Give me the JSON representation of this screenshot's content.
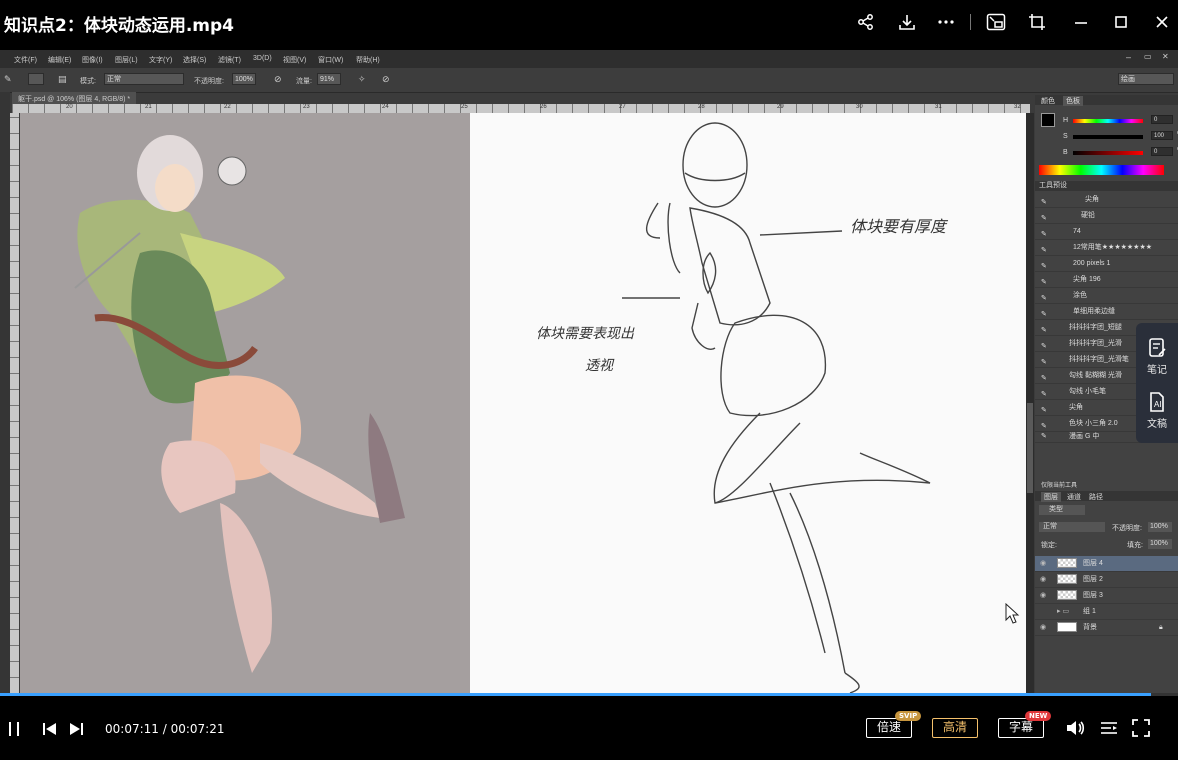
{
  "window": {
    "title": "知识点2：体块动态运用.mp4",
    "icons": [
      "share-icon",
      "download-icon",
      "more-icon",
      "picture-in-picture-icon",
      "crop-icon",
      "minimize-icon",
      "maximize-icon",
      "close-icon"
    ]
  },
  "photoshop": {
    "menu": [
      "文件(F)",
      "编辑(E)",
      "图像(I)",
      "图层(L)",
      "文字(Y)",
      "选择(S)",
      "滤镜(T)",
      "3D(D)",
      "视图(V)",
      "窗口(W)",
      "帮助(H)"
    ],
    "options": {
      "mode_label": "模式:",
      "mode_value": "正常",
      "opacity_label": "不透明度:",
      "opacity_value": "100%",
      "flow_label": "流量:",
      "flow_value": "91%",
      "workspace": "绘画"
    },
    "doc_tab": "躯干.psd @ 106% (图层 4, RGB/8) *",
    "ruler_numbers": [
      "20",
      "21",
      "22",
      "23",
      "24",
      "25",
      "26",
      "27",
      "28",
      "29",
      "30",
      "31",
      "32"
    ],
    "sketch_notes": {
      "thickness": "体块要有厚度",
      "highlight_line1": "体块需要表现出",
      "highlight_line2": "透视"
    },
    "color_panel": {
      "tabs": [
        "颜色",
        "色板"
      ],
      "h_label": "H",
      "h_value": "0",
      "s_label": "S",
      "s_value": "100",
      "b_label": "B",
      "b_value": "0",
      "percent": "%"
    },
    "tool_presets": {
      "title": "工具预设",
      "items": [
        "尖角",
        "硬铅",
        "74",
        "12常用笔★★★★★★★★",
        "200 pixels 1",
        "尖角 196",
        "涂色",
        "单细用柔边缝",
        "抖抖抖字团_短腿",
        "抖抖抖字团_光滑",
        "抖抖抖字团_光滑笔",
        "勾线 黏糊糊 光滑",
        "勾线 小毛笔",
        "尖角",
        "色块 小三角 2.0",
        "漫画 G 中"
      ],
      "footer": "仅限当前工具"
    },
    "layers": {
      "tabs": [
        "图层",
        "通道",
        "路径"
      ],
      "filter": "类型",
      "blend": "正常",
      "opacity_label": "不透明度:",
      "opacity_value": "100%",
      "lock_label": "锁定:",
      "fill_label": "填充:",
      "fill_value": "100%",
      "items": [
        {
          "name": "图层 4",
          "selected": true
        },
        {
          "name": "图层 2",
          "selected": false
        },
        {
          "name": "图层 3",
          "selected": false
        },
        {
          "name": "组 1",
          "selected": false
        },
        {
          "name": "背景",
          "selected": false
        }
      ]
    }
  },
  "side_panel": {
    "notes_label": "笔记",
    "doc_label": "文稿"
  },
  "player": {
    "progress_fraction": 0.977,
    "current_time": "00:07:11",
    "total_time": "00:07:21",
    "time_separator": " / ",
    "speed_label": "倍速",
    "speed_badge": "SVIP",
    "quality_label": "高清",
    "subtitle_label": "字幕",
    "subtitle_badge": "NEW",
    "colors": {
      "accent": "#39a0ff",
      "hd": "#f5c16c",
      "svip_badge": "#c8963e",
      "new_badge": "#e0383b"
    }
  }
}
